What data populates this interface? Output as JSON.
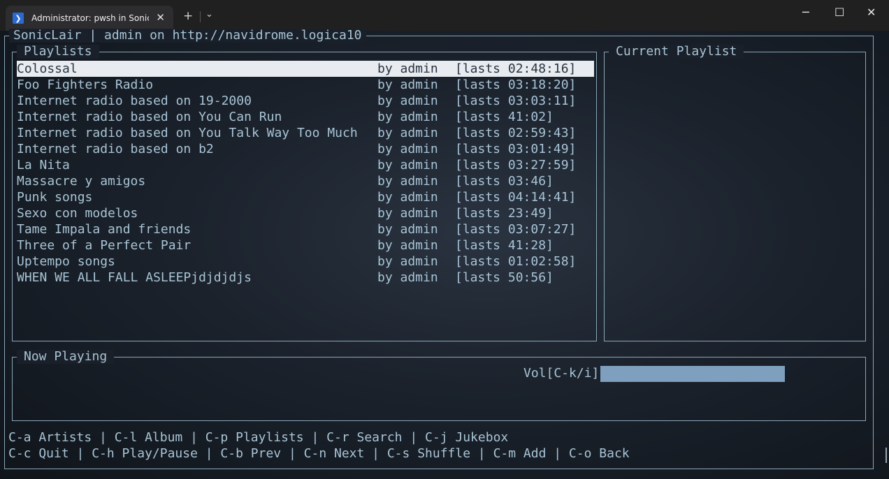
{
  "window": {
    "tab_title": "Administrator: pwsh in SonicL",
    "tab_icon": "powershell-icon",
    "close_tab_glyph": "✕",
    "new_tab_glyph": "+",
    "dropdown_glyph": "⌄",
    "minimize_glyph": "─",
    "maximize_glyph": "☐",
    "close_glyph": "✕"
  },
  "app": {
    "header": "SonicLair | admin on http://navidrome.logica10"
  },
  "playlists_panel": {
    "title": "Playlists",
    "selected_index": 0,
    "items": [
      {
        "name": "Colossal",
        "owner": "by admin",
        "duration": "[lasts 02:48:16]"
      },
      {
        "name": "Foo Fighters Radio",
        "owner": "by admin",
        "duration": "[lasts 03:18:20]"
      },
      {
        "name": "Internet radio based on 19-2000",
        "owner": "by admin",
        "duration": "[lasts 03:03:11]"
      },
      {
        "name": "Internet radio based on You Can Run",
        "owner": "by admin",
        "duration": "[lasts 41:02]"
      },
      {
        "name": "Internet radio based on You Talk Way Too Much",
        "owner": "by admin",
        "duration": "[lasts 02:59:43]"
      },
      {
        "name": "Internet radio based on b2",
        "owner": "by admin",
        "duration": "[lasts 03:01:49]"
      },
      {
        "name": "La Nita",
        "owner": "by admin",
        "duration": "[lasts 03:27:59]"
      },
      {
        "name": "Massacre y amigos",
        "owner": "by admin",
        "duration": "[lasts 03:46]"
      },
      {
        "name": "Punk songs",
        "owner": "by admin",
        "duration": "[lasts 04:14:41]"
      },
      {
        "name": "Sexo con modelos",
        "owner": "by admin",
        "duration": "[lasts 23:49]"
      },
      {
        "name": "Tame Impala and friends",
        "owner": "by admin",
        "duration": "[lasts 03:07:27]"
      },
      {
        "name": "Three of a Perfect Pair",
        "owner": "by admin",
        "duration": "[lasts 41:28]"
      },
      {
        "name": "Uptempo songs",
        "owner": "by admin",
        "duration": "[lasts 01:02:58]"
      },
      {
        "name": "WHEN WE ALL FALL ASLEEPjdjdjdjs",
        "owner": "by admin",
        "duration": "[lasts 50:56]"
      }
    ]
  },
  "current_playlist_panel": {
    "title": "Current Playlist"
  },
  "now_playing_panel": {
    "title": "Now Playing",
    "volume_label": "Vol[C-k/i]",
    "volume_level": 1.0
  },
  "help": {
    "line1": "C-a Artists | C-l Album | C-p Playlists | C-r Search | C-j Jukebox",
    "line2": "C-c Quit | C-h Play/Pause | C-b Prev | C-n Next | C-s Shuffle | C-m Add | C-o Back"
  },
  "colors": {
    "border": "#8ba6b8",
    "text": "#a8c4d6",
    "selection_bg": "#e8ecf0",
    "volume_bar": "#7e9fbd",
    "titlebar": "#202020"
  }
}
